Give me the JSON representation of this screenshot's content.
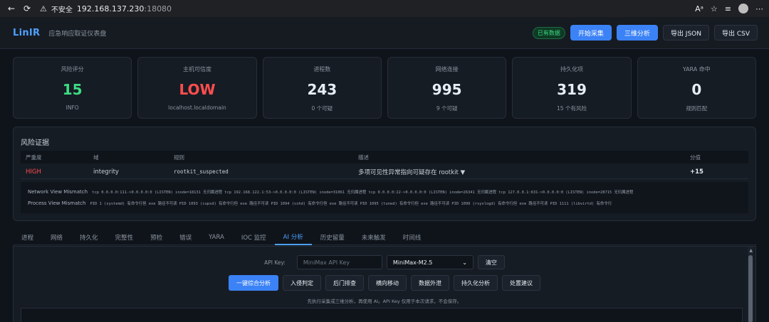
{
  "browser": {
    "back_icon": "arrow-left-icon",
    "reload_icon": "reload-icon",
    "insecure_label": "不安全",
    "host": "192.168.137.230",
    "port": ":18080"
  },
  "header": {
    "brand": "LinIR",
    "subtitle": "应急响应取证仪表盘",
    "status_badge": "已有数据",
    "buttons": [
      "开始采集",
      "三维分析",
      "导出 JSON",
      "导出 CSV"
    ]
  },
  "cards": [
    {
      "label": "风险评分",
      "value": "15",
      "sub": "INFO",
      "color": "#3ddc84"
    },
    {
      "label": "主机可信度",
      "value": "LOW",
      "sub": "localhost.localdomain",
      "color": "#ff4d4f"
    },
    {
      "label": "进程数",
      "value": "243",
      "sub": "0 个可疑"
    },
    {
      "label": "网络连接",
      "value": "995",
      "sub": "9 个可疑"
    },
    {
      "label": "持久化项",
      "value": "319",
      "sub": "15 个有风险"
    },
    {
      "label": "YARA 命中",
      "value": "0",
      "sub": "规则匹配"
    }
  ],
  "risk": {
    "title": "风险证据",
    "columns": [
      "严重度",
      "域",
      "规则",
      "描述",
      "分值"
    ],
    "row": {
      "severity": "HIGH",
      "domain": "integrity",
      "rule": "rootkit_suspected",
      "description": "多项可见性异常指向可疑存在 rootkit ▼",
      "score": "+15"
    },
    "details": [
      {
        "key": "Network View Mismatch",
        "text": "tcp 0.0.0.0:111->0.0.0.0:0 (LISTEN) inode=18131 无归属进程  tcp 192.168.122.1:53->0.0.0.0:0 (LISTEN) inode=31061 无归属进程  tcp 0.0.0.0:22->0.0.0.0:0 (LISTEN) inode=26341 无归属进程  tcp 127.0.0.1:631->0.0.0.0:0 (LISTEN) inode=28715 无归属进程"
      },
      {
        "key": "Process View Mismatch",
        "text": "PID 1 (systemd) 有命令行但 exe 路径不可读  PID 1093 (cupsd) 有命令行但 exe 路径不可读  PID 1094 (sshd) 有命令行但 exe 路径不可读  PID 1095 (tuned) 有命令行但 exe 路径不可读  PID 1099 (rsyslogd) 有命令行但 exe 路径不可读  PID 1111 (libvirtd) 有命令行"
      }
    ]
  },
  "tabs": [
    "进程",
    "网络",
    "持久化",
    "完整性",
    "预检",
    "错误",
    "YARA",
    "IOC 监控",
    "AI 分析",
    "历史留量",
    "未来触发",
    "时间线"
  ],
  "active_tab": "AI 分析",
  "ai": {
    "api_label": "API Key:",
    "api_placeholder": "MiniMax API Key",
    "model": "MiniMax-M2.5",
    "clear": "清空",
    "actions": [
      "一键综合分析",
      "入侵判定",
      "后门排查",
      "横向移动",
      "数据外泄",
      "持久化分析",
      "处置建议"
    ],
    "hint": "先执行采集或三维分析，再使用 AI。API Key 仅用于本次请求，不会保存。"
  }
}
